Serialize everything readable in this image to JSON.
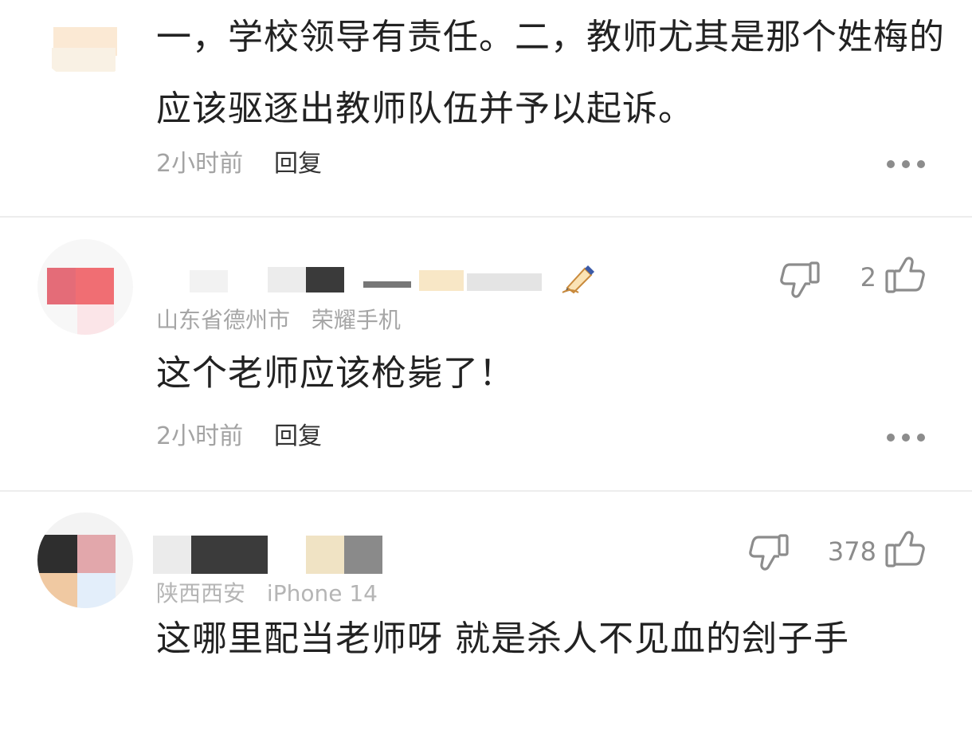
{
  "comments": [
    {
      "body": "一，学校领导有责任。二，教师尤其是那个姓梅的应该驱逐出教师队伍并予以起诉。",
      "time": "2小时前",
      "reply": "回复"
    },
    {
      "location": "山东省德州市",
      "device": "荣耀手机",
      "likes": "2",
      "body": "这个老师应该枪毙了！",
      "time": "2小时前",
      "reply": "回复"
    },
    {
      "location": "陕西西安",
      "device": "iPhone 14",
      "likes": "378",
      "body": "这哪里配当老师呀 就是杀人不见血的刽子手"
    }
  ],
  "icons": {
    "dislike": "thumbs-down-icon",
    "like": "thumbs-up-icon",
    "more": "more-dots-icon",
    "badge": "pen-icon"
  },
  "colors": {
    "text": "#222222",
    "meta": "#a3a3a3",
    "icon": "#8c8c8c",
    "divider": "#ededed"
  }
}
